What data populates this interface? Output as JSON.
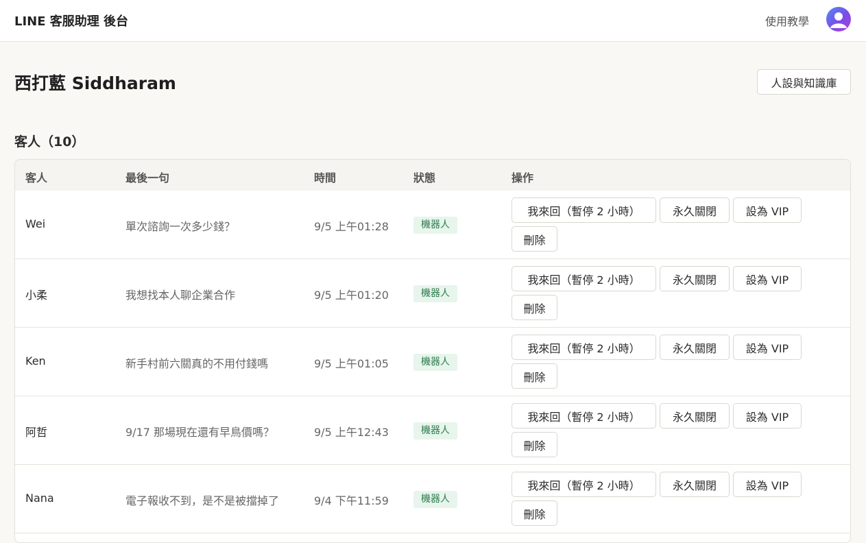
{
  "header": {
    "app_title": "LINE 客服助理 後台",
    "tutorial_label": "使用教學"
  },
  "page": {
    "title": "西打藍 Siddharam",
    "persona_button_label": "人設與知識庫"
  },
  "customers": {
    "section_title": "客人（10）",
    "columns": {
      "customer": "客人",
      "last_message": "最後一句",
      "time": "時間",
      "status": "狀態",
      "actions": "操作"
    },
    "action_labels": {
      "takeover": "我來回（暫停 2 小時）",
      "close": "永久關閉",
      "vip": "設為 VIP",
      "delete": "刪除"
    },
    "rows": [
      {
        "name": "Wei",
        "last_message": "單次諮詢一次多少錢？",
        "time": "9/5 上午01:28",
        "status": "機器人"
      },
      {
        "name": "小柔",
        "last_message": "我想找本人聊企業合作",
        "time": "9/5 上午01:20",
        "status": "機器人"
      },
      {
        "name": "Ken",
        "last_message": "新手村前六關真的不用付錢嗎",
        "time": "9/5 上午01:05",
        "status": "機器人"
      },
      {
        "name": "阿哲",
        "last_message": "9/17 那場現在還有早鳥價嗎？",
        "time": "9/5 上午12:43",
        "status": "機器人"
      },
      {
        "name": "Nana",
        "last_message": "電子報收不到，是不是被擋掉了",
        "time": "9/4 下午11:59",
        "status": "機器人"
      }
    ]
  },
  "colors": {
    "accent_gradient_start": "#4f8df6",
    "accent_gradient_end": "#b23fd9",
    "badge_bg": "#e7f5ec",
    "badge_text": "#2e7d4f"
  }
}
